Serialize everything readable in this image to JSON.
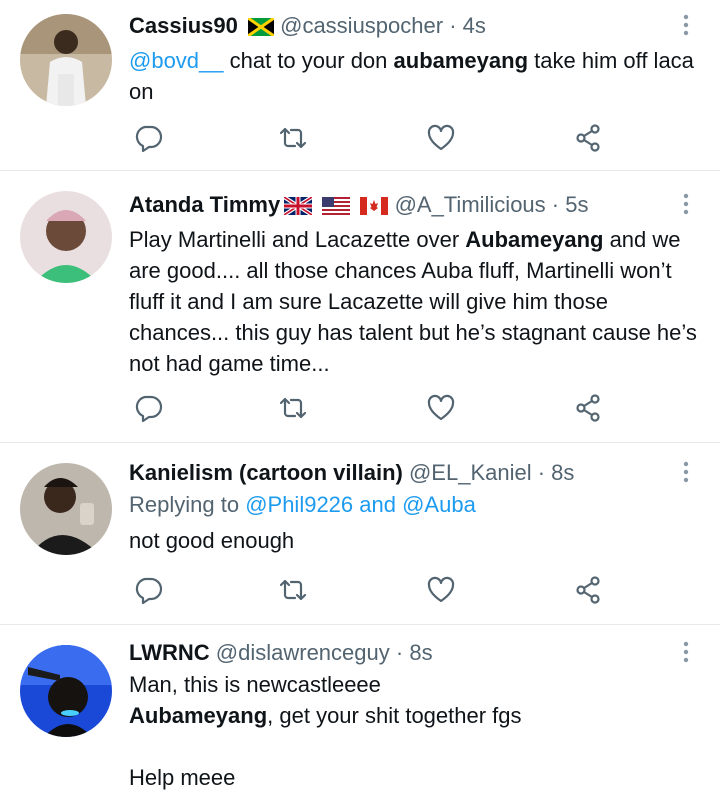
{
  "tweets": [
    {
      "name": "Cassius90",
      "handle": "@cassiuspocher",
      "time": "4s",
      "mention": "@bovd__",
      "text_a": " chat to your don ",
      "bold": "aubameyang",
      "text_b": " take him off laca on",
      "flags": [
        "jamaica-flag"
      ]
    },
    {
      "name": "Atanda Timmy",
      "handle": "@A_Timilicious",
      "time": "5s",
      "text_a": "Play Martinelli and Lacazette over ",
      "bold": "Aubameyang",
      "text_b": " and we are good.... all those chances Auba fluff, Martinelli won’t fluff it and I am sure Lacazette will give him those chances... this guy has talent but he’s stagnant cause he’s not had game time...",
      "flags": [
        "uk-flag",
        "usa-flag",
        "canada-flag"
      ]
    },
    {
      "name": "Kanielism (cartoon villain)",
      "handle": "@EL_Kaniel",
      "time": "8s",
      "reply_prefix": "Replying to ",
      "reply_user1": "@Phil9226",
      "reply_and": " and ",
      "reply_user2": "@Auba",
      "text": "not good enough"
    },
    {
      "name": "LWRNC",
      "handle": "@dislawrenceguy",
      "time": "8s",
      "line1": "Man, this is newcastleeee",
      "bold": "Aubameyang",
      "line2_rest": ", get your shit together fgs",
      "line3": "Help meee"
    }
  ],
  "separator": " · ",
  "colors": {
    "accent": "#1d9bf0",
    "muted": "#536471",
    "text": "#0f1419",
    "divider": "#e6e9ec"
  },
  "icons": [
    "reply-icon",
    "retweet-icon",
    "like-icon",
    "share-icon",
    "more-options-icon"
  ]
}
